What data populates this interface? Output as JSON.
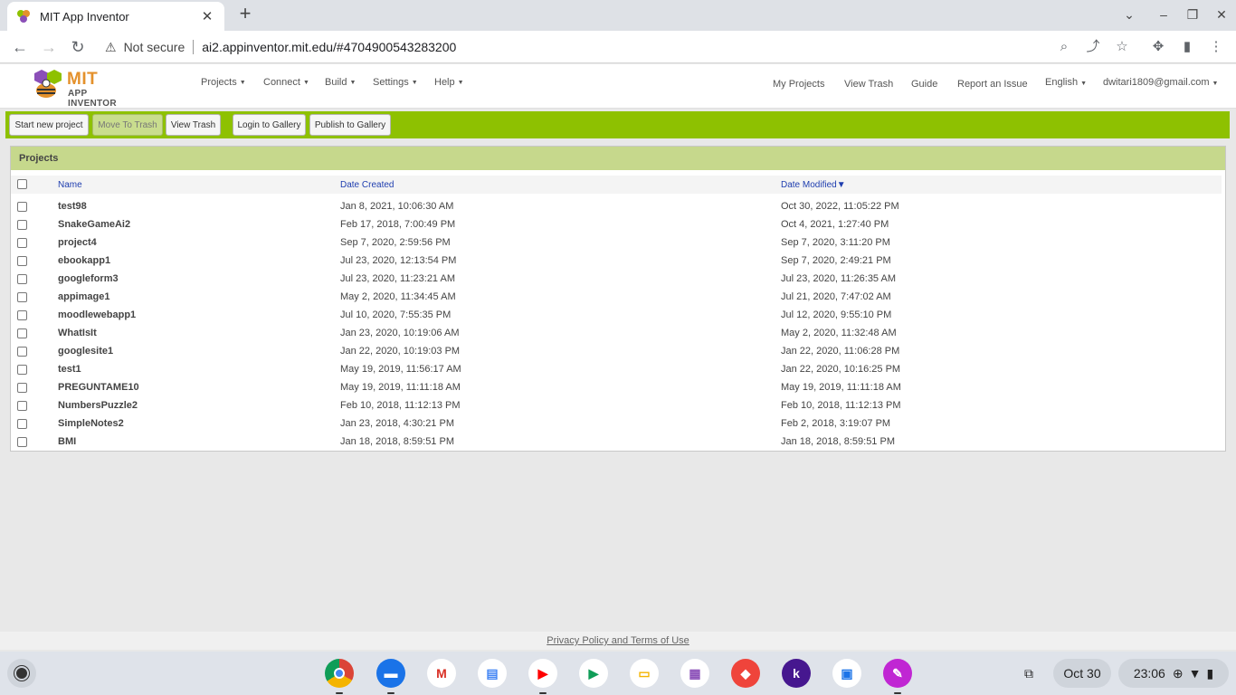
{
  "browser": {
    "tab_title": "MIT App Inventor",
    "not_secure": "Not secure",
    "url": "ai2.appinventor.mit.edu/#4704900543283200"
  },
  "header": {
    "logo_mit": "MIT",
    "logo_sub": "APP INVENTOR",
    "menus": [
      "Projects",
      "Connect",
      "Build",
      "Settings",
      "Help"
    ],
    "links": {
      "my_projects": "My Projects",
      "view_trash": "View Trash",
      "guide": "Guide",
      "report_issue": "Report an Issue",
      "language": "English",
      "account": "dwitari1809@gmail.com"
    }
  },
  "toolbar": {
    "start_new": "Start new project",
    "move_to_trash": "Move To Trash",
    "view_trash": "View Trash",
    "login_gallery": "Login to Gallery",
    "publish_gallery": "Publish to Gallery"
  },
  "projects": {
    "title": "Projects",
    "columns": {
      "name": "Name",
      "created": "Date Created",
      "modified": "Date Modified"
    },
    "sort_indicator": "▼",
    "rows": [
      {
        "name": "test98",
        "created": "Jan 8, 2021, 10:06:30 AM",
        "modified": "Oct 30, 2022, 11:05:22 PM"
      },
      {
        "name": "SnakeGameAi2",
        "created": "Feb 17, 2018, 7:00:49 PM",
        "modified": "Oct 4, 2021, 1:27:40 PM"
      },
      {
        "name": "project4",
        "created": "Sep 7, 2020, 2:59:56 PM",
        "modified": "Sep 7, 2020, 3:11:20 PM"
      },
      {
        "name": "ebookapp1",
        "created": "Jul 23, 2020, 12:13:54 PM",
        "modified": "Sep 7, 2020, 2:49:21 PM"
      },
      {
        "name": "googleform3",
        "created": "Jul 23, 2020, 11:23:21 AM",
        "modified": "Jul 23, 2020, 11:26:35 AM"
      },
      {
        "name": "appimage1",
        "created": "May 2, 2020, 11:34:45 AM",
        "modified": "Jul 21, 2020, 7:47:02 AM"
      },
      {
        "name": "moodlewebapp1",
        "created": "Jul 10, 2020, 7:55:35 PM",
        "modified": "Jul 12, 2020, 9:55:10 PM"
      },
      {
        "name": "WhatIsIt",
        "created": "Jan 23, 2020, 10:19:06 AM",
        "modified": "May 2, 2020, 11:32:48 AM"
      },
      {
        "name": "googlesite1",
        "created": "Jan 22, 2020, 10:19:03 PM",
        "modified": "Jan 22, 2020, 11:06:28 PM"
      },
      {
        "name": "test1",
        "created": "May 19, 2019, 11:56:17 AM",
        "modified": "Jan 22, 2020, 10:16:25 PM"
      },
      {
        "name": "PREGUNTAME10",
        "created": "May 19, 2019, 11:11:18 AM",
        "modified": "May 19, 2019, 11:11:18 AM"
      },
      {
        "name": "NumbersPuzzle2",
        "created": "Feb 10, 2018, 11:12:13 PM",
        "modified": "Feb 10, 2018, 11:12:13 PM"
      },
      {
        "name": "SimpleNotes2",
        "created": "Jan 23, 2018, 4:30:21 PM",
        "modified": "Feb 2, 2018, 3:19:07 PM"
      },
      {
        "name": "BMI",
        "created": "Jan 18, 2018, 8:59:51 PM",
        "modified": "Jan 18, 2018, 8:59:51 PM"
      }
    ]
  },
  "footer": {
    "privacy": "Privacy Policy and Terms of Use"
  },
  "shelf": {
    "date": "Oct 30",
    "time": "23:06",
    "apps": [
      "chrome-icon",
      "files-icon",
      "gmail-icon",
      "docs-icon",
      "youtube-icon",
      "play-store-icon",
      "keep-icon",
      "photos-icon",
      "anydesk-icon",
      "kahoot-icon",
      "screenshot-icon",
      "canvas-icon"
    ]
  },
  "colors": {
    "toolbar_green": "#8ec101",
    "panel_header": "#c6d88c",
    "link_blue": "#1f3eaf"
  }
}
